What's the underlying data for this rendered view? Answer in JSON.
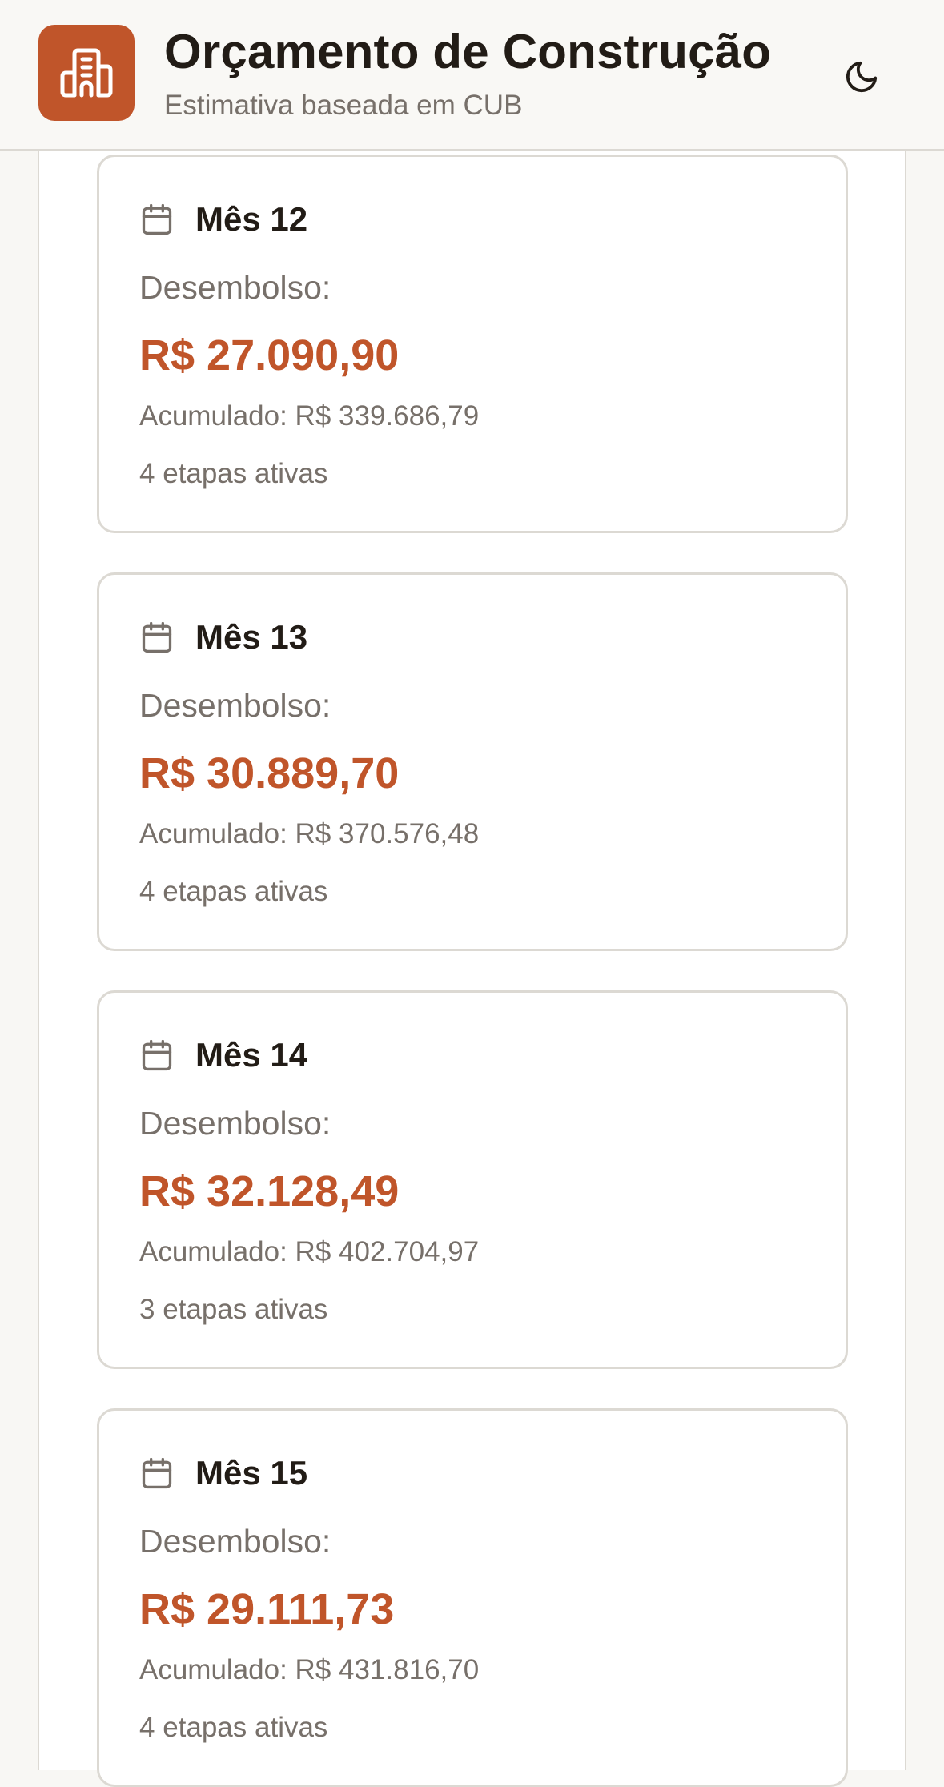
{
  "header": {
    "title": "Orçamento de Construção",
    "subtitle": "Estimativa baseada em CUB",
    "logo_icon": "building-icon",
    "theme_toggle_icon": "moon-icon"
  },
  "colors": {
    "accent": "#c0552a",
    "text_primary": "#221c16",
    "text_muted": "#77706a",
    "border": "#dcd9d3"
  },
  "months": [
    {
      "title": "Mês 12",
      "disbursement_label": "Desembolso:",
      "disbursement_value": "R$ 27.090,90",
      "accumulated": "Acumulado: R$ 339.686,79",
      "active_stages": "4 etapas ativas"
    },
    {
      "title": "Mês 13",
      "disbursement_label": "Desembolso:",
      "disbursement_value": "R$ 30.889,70",
      "accumulated": "Acumulado: R$ 370.576,48",
      "active_stages": "4 etapas ativas"
    },
    {
      "title": "Mês 14",
      "disbursement_label": "Desembolso:",
      "disbursement_value": "R$ 32.128,49",
      "accumulated": "Acumulado: R$ 402.704,97",
      "active_stages": "3 etapas ativas"
    },
    {
      "title": "Mês 15",
      "disbursement_label": "Desembolso:",
      "disbursement_value": "R$ 29.111,73",
      "accumulated": "Acumulado: R$ 431.816,70",
      "active_stages": "4 etapas ativas"
    }
  ]
}
